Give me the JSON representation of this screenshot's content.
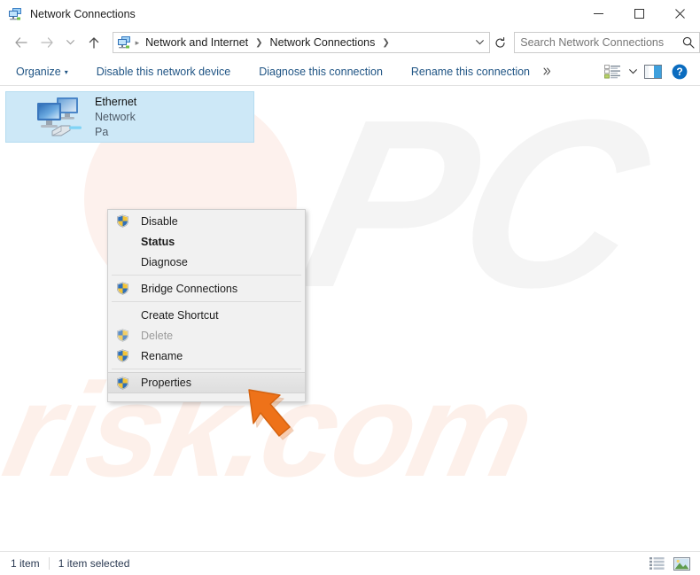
{
  "window": {
    "title": "Network Connections",
    "icon": "network-connections-icon",
    "controls": {
      "minimize": "—",
      "maximize": "☐",
      "close": "✕"
    }
  },
  "nav": {
    "back": "←",
    "forward": "→",
    "recent": "⌄",
    "up": "↑",
    "refresh": "↻",
    "dropdown": "⌄"
  },
  "address": {
    "icon": "network-connections-icon",
    "crumbs": [
      {
        "label": "Network and Internet"
      },
      {
        "label": "Network Connections"
      }
    ],
    "separator": "❯"
  },
  "search": {
    "placeholder": "Search Network Connections",
    "value": "",
    "icon": "search-icon"
  },
  "toolbar": {
    "organize": "Organize",
    "organize_caret": "▾",
    "disable_device": "Disable this network device",
    "diagnose_connection": "Diagnose this connection",
    "rename_connection": "Rename this connection",
    "overflow": "»",
    "change_view": "change-view-icon",
    "view_caret": "▾",
    "preview_pane": "preview-pane-icon",
    "help": "?"
  },
  "content": {
    "items": [
      {
        "name": "Ethernet",
        "line2": "Network",
        "line3": "Pa",
        "icon": "network-adapter-icon",
        "selected": true
      }
    ]
  },
  "context_menu": {
    "items": [
      {
        "label": "Disable",
        "shield": true,
        "bold": false,
        "disabled": false,
        "highlight": false,
        "sep_after": false
      },
      {
        "label": "Status",
        "shield": false,
        "bold": true,
        "disabled": false,
        "highlight": false,
        "sep_after": false
      },
      {
        "label": "Diagnose",
        "shield": false,
        "bold": false,
        "disabled": false,
        "highlight": false,
        "sep_after": true
      },
      {
        "label": "Bridge Connections",
        "shield": true,
        "bold": false,
        "disabled": false,
        "highlight": false,
        "sep_after": true
      },
      {
        "label": "Create Shortcut",
        "shield": false,
        "bold": false,
        "disabled": false,
        "highlight": false,
        "sep_after": false
      },
      {
        "label": "Delete",
        "shield": true,
        "bold": false,
        "disabled": true,
        "highlight": false,
        "sep_after": false
      },
      {
        "label": "Rename",
        "shield": true,
        "bold": false,
        "disabled": false,
        "highlight": false,
        "sep_after": true
      },
      {
        "label": "Properties",
        "shield": true,
        "bold": false,
        "disabled": false,
        "highlight": true,
        "sep_after": false
      }
    ]
  },
  "statusbar": {
    "item_count": "1 item",
    "selection": "1 item selected",
    "views": {
      "details": "details-view-icon",
      "large_icons": "large-icons-view-icon"
    }
  },
  "watermark": {
    "primary": "PC",
    "secondary": "risk.com"
  },
  "colors": {
    "selection_bg": "#cde8f7",
    "command_link": "#1f5484",
    "menu_bg": "#f1f1f1",
    "cursor_orange": "#ee7219",
    "help_blue": "#0b6cbf"
  }
}
